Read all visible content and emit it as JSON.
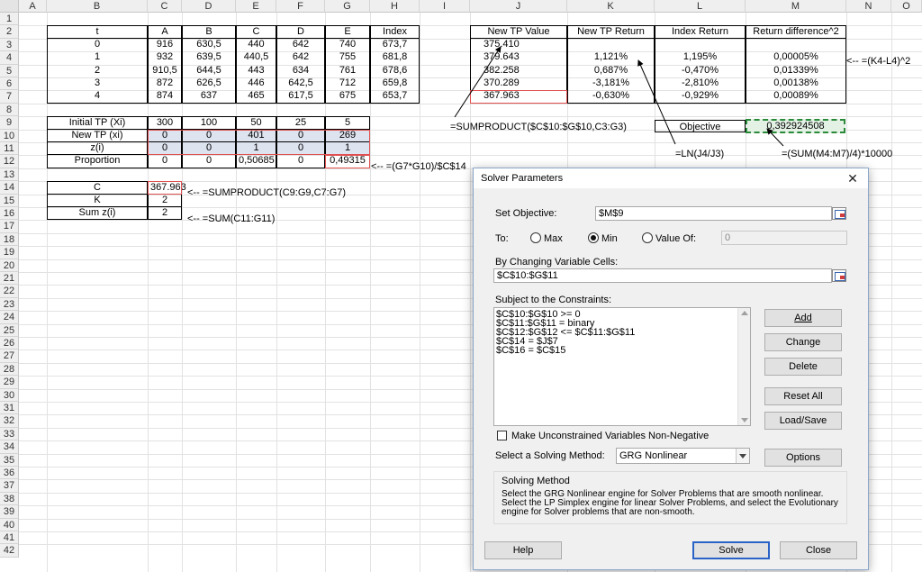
{
  "columns": [
    "A",
    "B",
    "C",
    "D",
    "E",
    "F",
    "G",
    "H",
    "I",
    "J",
    "K",
    "L",
    "M",
    "N",
    "O"
  ],
  "rows": [
    "1",
    "2",
    "3",
    "4",
    "5",
    "6",
    "7",
    "8",
    "9",
    "10",
    "11",
    "12",
    "13",
    "14",
    "15",
    "16",
    "17",
    "18",
    "19",
    "20",
    "21",
    "22",
    "23",
    "24",
    "25",
    "26",
    "27",
    "28",
    "29",
    "30",
    "31",
    "32",
    "33",
    "34",
    "35",
    "36",
    "37",
    "38",
    "39",
    "40",
    "41",
    "42"
  ],
  "table1": {
    "headers": [
      "t",
      "A",
      "B",
      "C",
      "D",
      "E",
      "Index"
    ],
    "rows": [
      [
        "0",
        "916",
        "630,5",
        "440",
        "642",
        "740",
        "673,7"
      ],
      [
        "1",
        "932",
        "639,5",
        "440,5",
        "642",
        "755",
        "681,8"
      ],
      [
        "2",
        "910,5",
        "644,5",
        "443",
        "634",
        "761",
        "678,6"
      ],
      [
        "3",
        "872",
        "626,5",
        "446",
        "642,5",
        "712",
        "659,8"
      ],
      [
        "4",
        "874",
        "637",
        "465",
        "617,5",
        "675",
        "653,7"
      ]
    ]
  },
  "table2": {
    "headers": [
      "New TP Value",
      "New TP Return",
      "Index Return",
      "Return difference^2"
    ],
    "rows": [
      [
        "375.410",
        "",
        "",
        ""
      ],
      [
        "379.643",
        "1,121%",
        "1,195%",
        "0,00005%"
      ],
      [
        "382.258",
        "0,687%",
        "-0,470%",
        "0,01339%"
      ],
      [
        "370.289",
        "-3,181%",
        "-2,810%",
        "0,00138%"
      ],
      [
        "367.963",
        "-0,630%",
        "-0,929%",
        "0,00089%"
      ]
    ]
  },
  "table3": {
    "rows": [
      [
        "Initial TP (Xi)",
        "300",
        "100",
        "50",
        "25",
        "5"
      ],
      [
        "New TP (xi)",
        "0",
        "0",
        "401",
        "0",
        "269"
      ],
      [
        "z(i)",
        "0",
        "0",
        "1",
        "0",
        "1"
      ],
      [
        "Proportion",
        "0",
        "0",
        "0,50685",
        "0",
        "0,49315"
      ]
    ]
  },
  "table4": {
    "rows": [
      [
        "C",
        "367.963"
      ],
      [
        "K",
        "2"
      ],
      [
        "Sum z(i)",
        "2"
      ]
    ]
  },
  "objective": {
    "label": "Objective",
    "value": "0,392924508"
  },
  "annotations": {
    "m4_formula": "<-- =(K4-L4)^2",
    "j9_formula": "=SUMPRODUCT($C$10:$G$10,C3:G3)",
    "k11_formula": "=LN(J4/J3)",
    "m11_formula": "=(SUM(M4:M7)/4)*10000",
    "proportion_formula": "<-- =(G7*G10)/$C$14",
    "c14_formula": "<-- =SUMPRODUCT(C9:G9,C7:G7)",
    "c16_formula": "<-- =SUM(C11:G11)"
  },
  "dialog": {
    "title": "Solver Parameters",
    "set_objective_label": "Set Objective:",
    "set_objective_value": "$M$9",
    "to_label": "To:",
    "max_label": "Max",
    "min_label": "Min",
    "value_of_label": "Value Of:",
    "value_of_value": "0",
    "changing_label": "By Changing Variable Cells:",
    "changing_value": "$C$10:$G$11",
    "constraints_label": "Subject to the Constraints:",
    "constraints": [
      "$C$10:$G$10 >= 0",
      "$C$11:$G$11 = binary",
      "$C$12:$G$12 <= $C$11:$G$11",
      "$C$14 = $J$7",
      "$C$16 = $C$15"
    ],
    "add_label": "Add",
    "change_label": "Change",
    "delete_label": "Delete",
    "reset_label": "Reset All",
    "loadsave_label": "Load/Save",
    "unconstrained_label": "Make Unconstrained Variables Non-Negative",
    "method_label": "Select a Solving Method:",
    "method_value": "GRG Nonlinear",
    "options_label": "Options",
    "solving_method_title": "Solving Method",
    "solving_method_text": "Select the GRG Nonlinear engine for Solver Problems that are smooth nonlinear. Select the LP Simplex engine for linear Solver Problems, and select the Evolutionary engine for Solver problems that are non-smooth.",
    "help_label": "Help",
    "solve_label": "Solve",
    "close_label": "Close"
  }
}
